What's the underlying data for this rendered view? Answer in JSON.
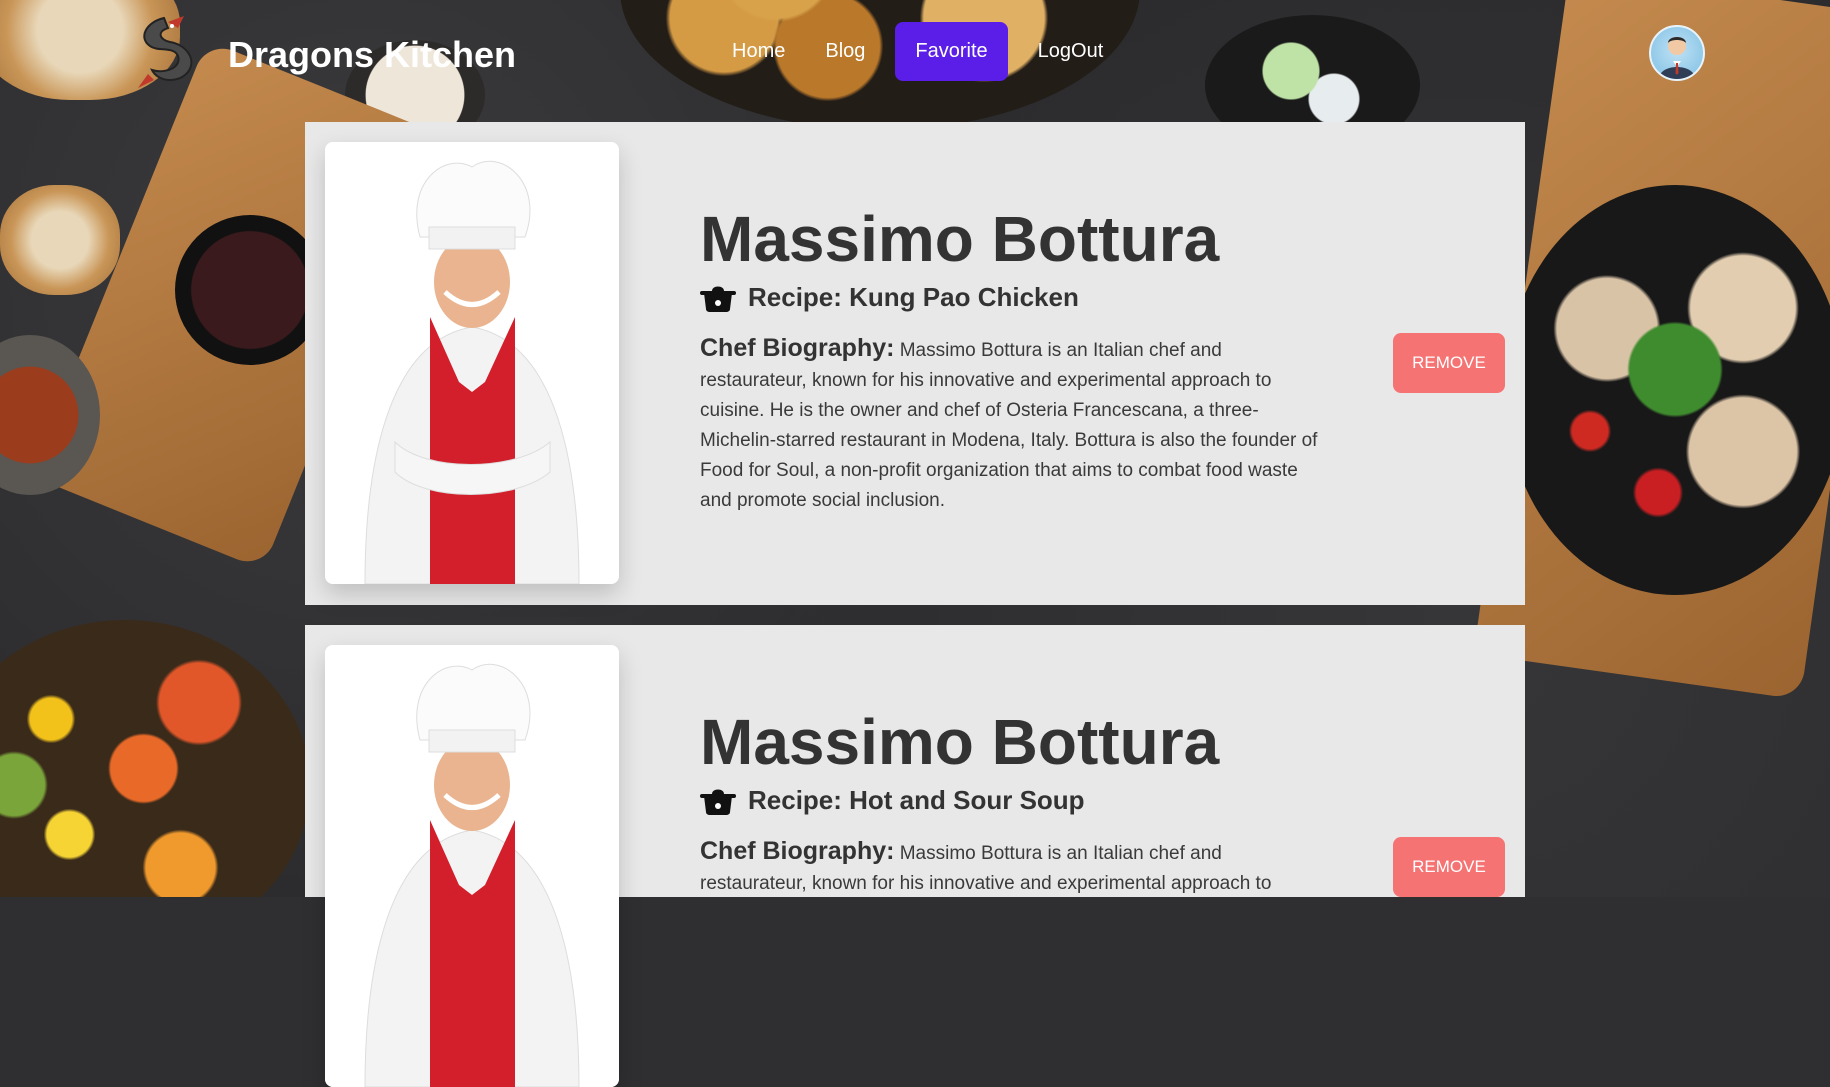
{
  "navbar": {
    "brand": "Dragons Kitchen",
    "links": [
      "Home",
      "Blog",
      "Favorite",
      "LogOut"
    ],
    "active_link": "Favorite",
    "accent_color": "#5a1ee8",
    "logo_icon": "dragon-icon",
    "avatar_icon": "user-avatar-icon"
  },
  "favorites": [
    {
      "chef_name": "Massimo Bottura",
      "recipe": "Recipe: Kung Pao Chicken",
      "bio_label": "Chef Biography:",
      "bio_text": "Massimo Bottura is an Italian chef and restaurateur, known for his innovative and experimental approach to cuisine. He is the owner and chef of Osteria Francescana, a three-Michelin-starred restaurant in Modena, Italy. Bottura is also the founder of Food for Soul, a non-profit organization that aims to combat food waste and promote social inclusion.",
      "button": "REMOVE"
    },
    {
      "chef_name": "Massimo Bottura",
      "recipe": "Recipe: Hot and Sour Soup",
      "bio_label": "Chef Biography:",
      "bio_text": "Massimo Bottura is an Italian chef and restaurateur, known for his innovative and experimental approach to",
      "button": "REMOVE"
    }
  ],
  "colors": {
    "card_bg": "#e8e8e8",
    "remove_button": "#f57373"
  }
}
